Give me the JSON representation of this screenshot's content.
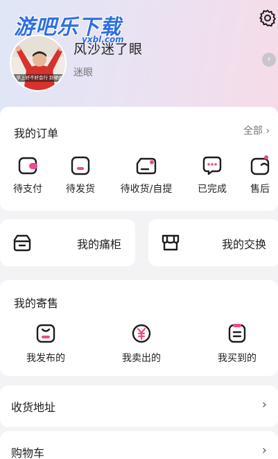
{
  "watermark": {
    "text": "游吧乐下载",
    "sub": "yxbl.com"
  },
  "profile": {
    "avatar_caption": "早上好不好会行 别硬曲",
    "username": "风沙迷了眼",
    "subtitle": "迷眼",
    "arrow": "›"
  },
  "orders": {
    "title": "我的订单",
    "all_label": "全部 ›",
    "items": [
      {
        "label": "待支付",
        "icon": "wallet-icon"
      },
      {
        "label": "待发货",
        "icon": "box-icon"
      },
      {
        "label": "待收货/自提",
        "icon": "delivery-icon"
      },
      {
        "label": "已完成",
        "icon": "chat-icon"
      },
      {
        "label": "售后",
        "icon": "return-icon"
      }
    ]
  },
  "tiles": {
    "cabinet": {
      "label": "我的痛柜",
      "icon": "cabinet-icon"
    },
    "exchange": {
      "label": "我的交换",
      "icon": "store-icon"
    }
  },
  "consign": {
    "title": "我的寄售",
    "items": [
      {
        "label": "我发布的",
        "icon": "bag-icon"
      },
      {
        "label": "我卖出的",
        "icon": "yen-icon"
      },
      {
        "label": "我买到的",
        "icon": "receipt-icon"
      }
    ]
  },
  "rows": {
    "address": {
      "label": "收货地址",
      "arrow": "›"
    },
    "cart": {
      "label": "购物车",
      "arrow": "›"
    }
  },
  "colors": {
    "accent": "#ee4a8e",
    "icon_stroke": "#1c1c1c"
  }
}
